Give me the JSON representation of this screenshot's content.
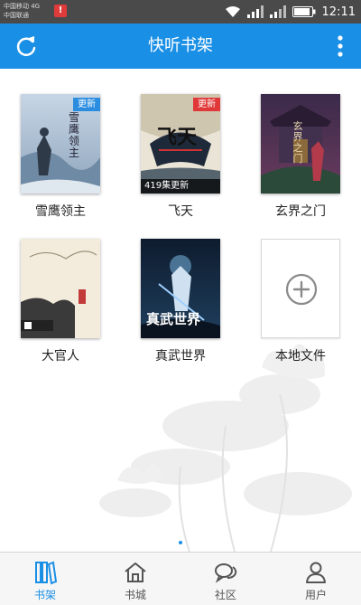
{
  "status_bar": {
    "carrier_1": "中国移动 4G",
    "carrier_2": "中国联通",
    "warning_glyph": "!",
    "battery_text": "88",
    "time": "12:11"
  },
  "app_bar": {
    "title": "快听书架",
    "refresh_icon": "refresh-icon",
    "more_icon": "more-vertical-icon",
    "color": "#1a8fe6"
  },
  "books": [
    {
      "title": "雪鹰领主",
      "badge": "更新",
      "badge_color": "blue",
      "cover_text": "雪鹰领主",
      "episodes": ""
    },
    {
      "title": "飞天",
      "badge": "更新",
      "badge_color": "red",
      "cover_text": "飞天",
      "episodes": "419集更新"
    },
    {
      "title": "玄界之门",
      "badge": "",
      "badge_color": "",
      "cover_text": "玄界之门",
      "episodes": ""
    },
    {
      "title": "大官人",
      "badge": "",
      "badge_color": "",
      "cover_text": "",
      "episodes": ""
    },
    {
      "title": "真武世界",
      "badge": "",
      "badge_color": "",
      "cover_text": "真武世界",
      "episodes": ""
    }
  ],
  "add_local": {
    "label": "本地文件",
    "icon": "plus-circle-icon"
  },
  "pager": {
    "active_page": 1,
    "total_pages": 1
  },
  "bottom_nav": [
    {
      "label": "书架",
      "icon": "bookshelf-icon",
      "active": true
    },
    {
      "label": "书城",
      "icon": "home-store-icon",
      "active": false
    },
    {
      "label": "社区",
      "icon": "chat-bubbles-icon",
      "active": false
    },
    {
      "label": "用户",
      "icon": "user-icon",
      "active": false
    }
  ]
}
